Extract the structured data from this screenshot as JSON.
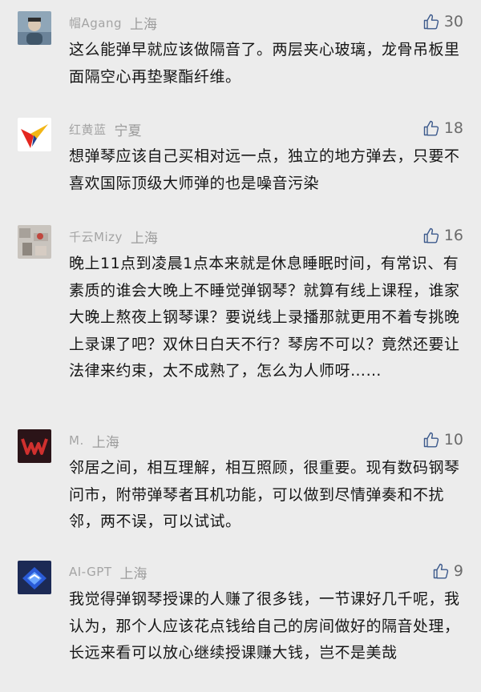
{
  "comments": [
    {
      "username": "帽Agang",
      "location": "上海",
      "likes": "30",
      "text": "这么能弹早就应该做隔音了。两层夹心玻璃，龙骨吊板里面隔空心再垫聚酯纤维。"
    },
    {
      "username": "红黄蓝",
      "location": "宁夏",
      "likes": "18",
      "text": "想弹琴应该自己买相对远一点，独立的地方弹去，只要不喜欢国际顶级大师弹的也是噪音污染"
    },
    {
      "username": "千云Mizy",
      "location": "上海",
      "likes": "16",
      "text": "晚上11点到凌晨1点本来就是休息睡眠时间，有常识、有素质的谁会大晚上不睡觉弹钢琴？就算有线上课程，谁家大晚上熬夜上钢琴课？要说线上录播那就更用不着专挑晚上录课了吧？双休日白天不行？琴房不可以？竟然还要让法律来约束，太不成熟了，怎么为人师呀……"
    },
    {
      "username": "M.",
      "location": "上海",
      "likes": "10",
      "text": "邻居之间，相互理解，相互照顾，很重要。现有数码钢琴问市，附带弹琴者耳机功能，可以做到尽情弹奏和不扰邻，两不误，可以试试。"
    },
    {
      "username": "AI-GPT",
      "location": "上海",
      "likes": "9",
      "text": "我觉得弹钢琴授课的人赚了很多钱，一节课好几千呢，我认为，那个人应该花点钱给自己的房间做好的隔音处理，长远来看可以放心继续授课赚大钱，岂不是美哉"
    }
  ]
}
